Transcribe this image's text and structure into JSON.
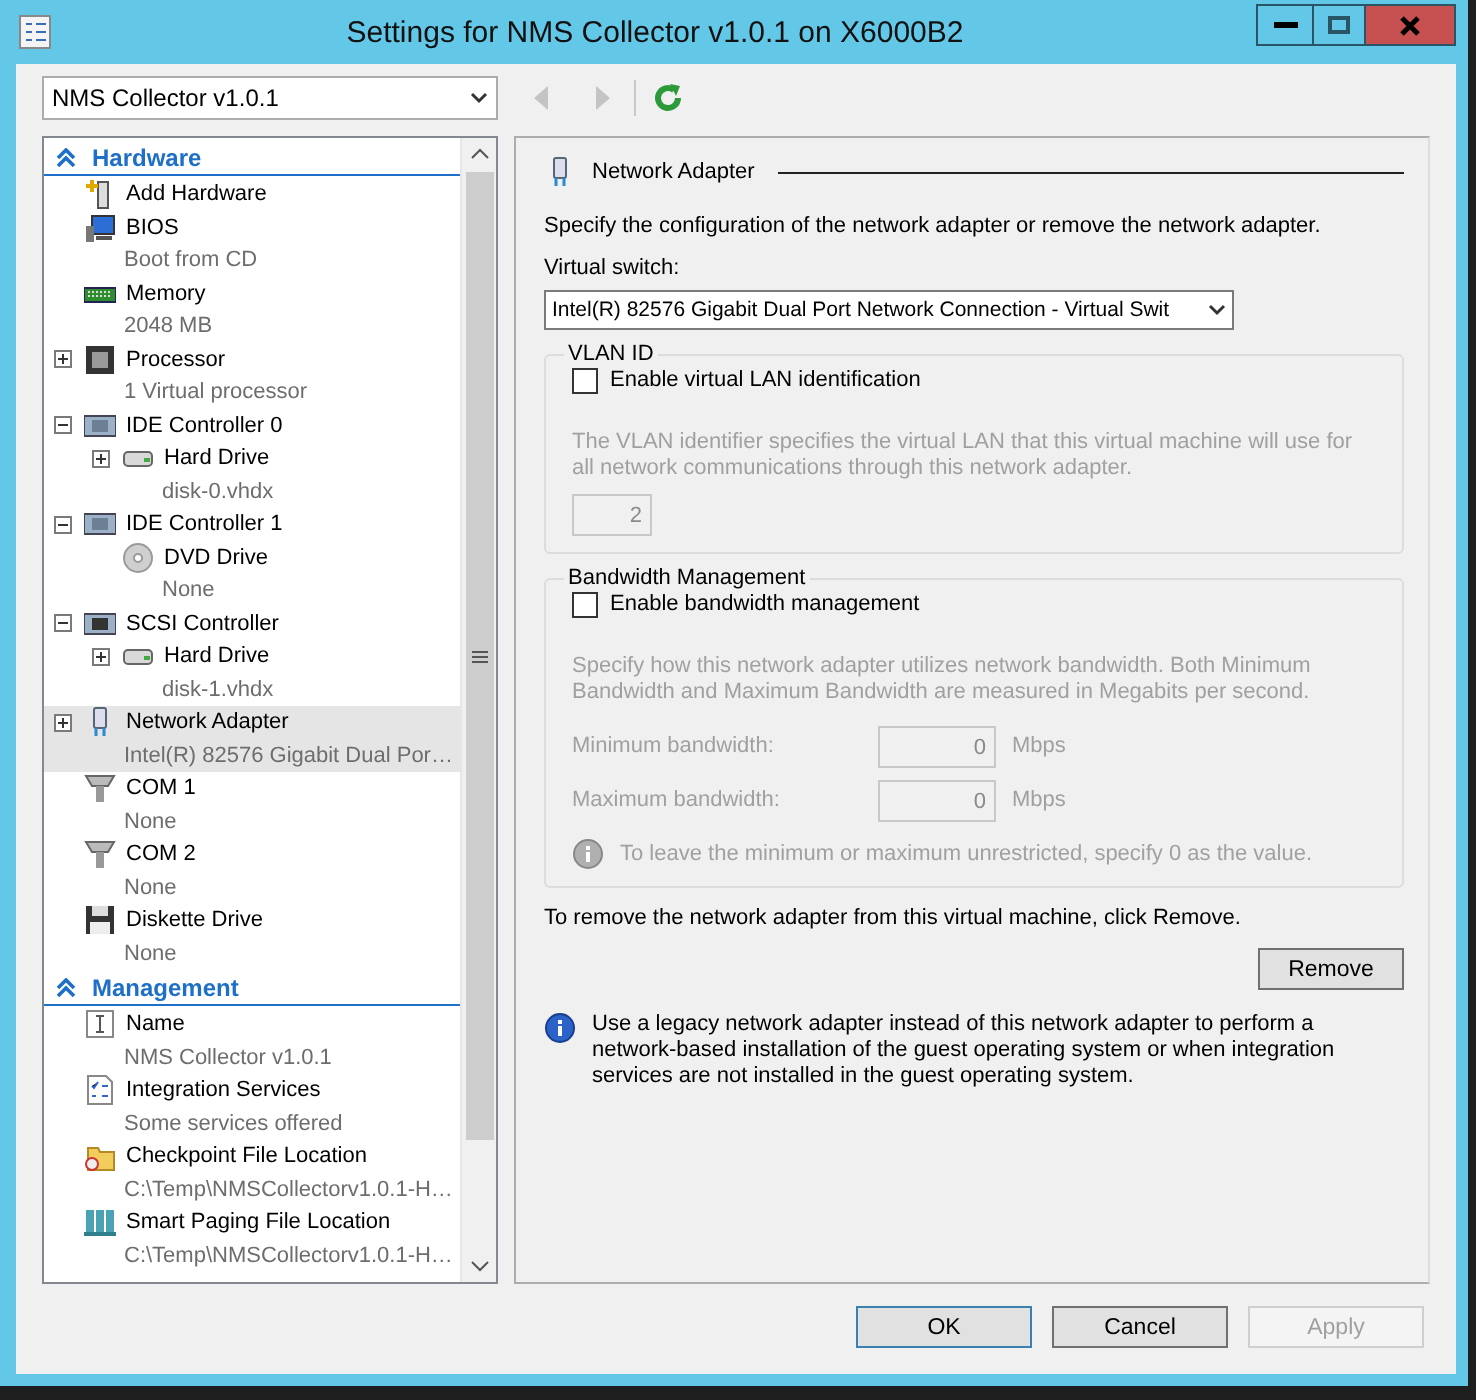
{
  "window": {
    "title": "Settings for NMS Collector v1.0.1 on X6000B2"
  },
  "vm_selector": {
    "value": "NMS Collector v1.0.1"
  },
  "nav_buttons": [
    {
      "kind": "back",
      "disabled": true
    },
    {
      "kind": "forward",
      "disabled": true
    },
    {
      "kind": "refresh",
      "disabled": false
    }
  ],
  "tree": {
    "sections": [
      {
        "title": "Hardware",
        "expanded": true,
        "items": [
          {
            "kind": "add",
            "label": "Add Hardware",
            "selected": false
          },
          {
            "kind": "bios",
            "label": "BIOS",
            "detail": "Boot from CD",
            "selected": false
          },
          {
            "kind": "memory",
            "label": "Memory",
            "detail": "2048 MB",
            "selected": false
          },
          {
            "kind": "processor",
            "label": "Processor",
            "detail": "1 Virtual processor",
            "expanded": false,
            "selected": false
          },
          {
            "kind": "ide",
            "label": "IDE Controller 0",
            "expanded": true,
            "selected": false,
            "children": [
              {
                "kind": "disk",
                "label": "Hard Drive",
                "detail": "disk-0.vhdx",
                "expanded": false,
                "selected": false
              }
            ]
          },
          {
            "kind": "ide",
            "label": "IDE Controller 1",
            "expanded": true,
            "selected": false,
            "children": [
              {
                "kind": "dvd",
                "label": "DVD Drive",
                "detail": "None",
                "selected": false
              }
            ]
          },
          {
            "kind": "scsi",
            "label": "SCSI Controller",
            "expanded": true,
            "selected": false,
            "children": [
              {
                "kind": "disk",
                "label": "Hard Drive",
                "detail": "disk-1.vhdx",
                "expanded": false,
                "selected": false
              }
            ]
          },
          {
            "kind": "network",
            "label": "Network Adapter",
            "detail": "Intel(R) 82576 Gigabit Dual Por…",
            "expanded": false,
            "selected": true
          },
          {
            "kind": "com",
            "label": "COM 1",
            "detail": "None",
            "selected": false
          },
          {
            "kind": "com",
            "label": "COM 2",
            "detail": "None",
            "selected": false
          },
          {
            "kind": "floppy",
            "label": "Diskette Drive",
            "detail": "None",
            "selected": false
          }
        ]
      },
      {
        "title": "Management",
        "expanded": true,
        "items": [
          {
            "kind": "name",
            "label": "Name",
            "detail": "NMS Collector v1.0.1",
            "selected": false
          },
          {
            "kind": "checklist",
            "label": "Integration Services",
            "detail": "Some services offered",
            "selected": false
          },
          {
            "kind": "folder",
            "label": "Checkpoint File Location",
            "detail": "C:\\Temp\\NMSCollectorv1.0.1-H…",
            "selected": false
          },
          {
            "kind": "paging",
            "label": "Smart Paging File Location",
            "detail": "C:\\Temp\\NMSCollectorv1.0.1-H…",
            "selected": false
          }
        ]
      }
    ]
  },
  "settings": {
    "heading": "Network Adapter",
    "description": "Specify the configuration of the network adapter or remove the network adapter.",
    "switch_label": "Virtual switch:",
    "switch_value": "Intel(R) 82576 Gigabit Dual Port Network Connection - Virtual Swit",
    "vlan": {
      "title": "VLAN ID",
      "checkbox": {
        "label": "Enable virtual LAN identification",
        "checked": false
      },
      "disabled": true,
      "note": "The VLAN identifier specifies the virtual LAN that this virtual machine will use for all network communications through this network adapter.",
      "value": "2"
    },
    "bandwidth": {
      "title": "Bandwidth Management",
      "checkbox": {
        "label": "Enable bandwidth management",
        "checked": false
      },
      "disabled": true,
      "note": "Specify how this network adapter utilizes network bandwidth. Both Minimum Bandwidth and Maximum Bandwidth are measured in Megabits per second.",
      "fields": [
        {
          "label": "Minimum bandwidth:",
          "value": "0",
          "unit": "Mbps"
        },
        {
          "label": "Maximum bandwidth:",
          "value": "0",
          "unit": "Mbps"
        }
      ],
      "hint": "To leave the minimum or maximum unrestricted, specify 0 as the value."
    },
    "remove_note": "To remove the network adapter from this virtual machine, click Remove.",
    "remove_button": "Remove",
    "info": "Use a legacy network adapter instead of this network adapter to perform a network-based installation of the guest operating system or when integration services are not installed in the guest operating system."
  },
  "buttons": [
    {
      "label": "OK",
      "default": true,
      "disabled": false
    },
    {
      "label": "Cancel",
      "default": false,
      "disabled": false
    },
    {
      "label": "Apply",
      "default": false,
      "disabled": true
    }
  ]
}
